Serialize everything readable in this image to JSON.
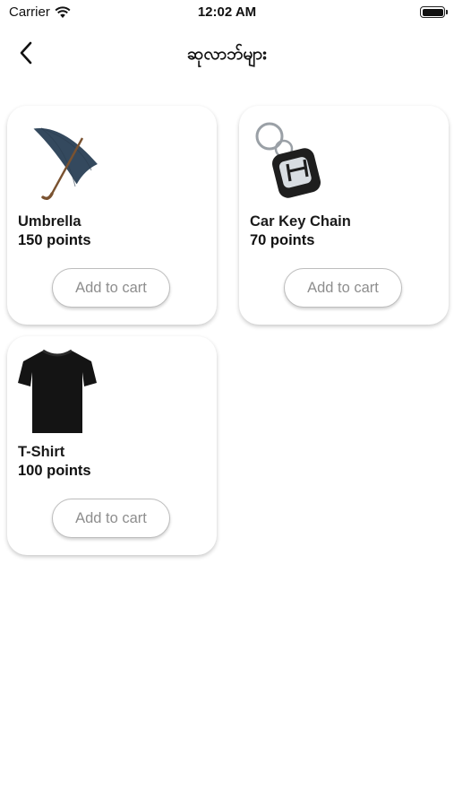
{
  "status_bar": {
    "carrier": "Carrier",
    "time": "12:02 AM"
  },
  "nav": {
    "title": "ဆုလာဘ်များ"
  },
  "products": [
    {
      "name": "Umbrella",
      "points": "150 points",
      "button_label": "Add to cart",
      "icon": "umbrella-image"
    },
    {
      "name": "Car Key Chain",
      "points": "70 points",
      "button_label": "Add to cart",
      "icon": "key-chain-image"
    },
    {
      "name": "T-Shirt",
      "points": "100 points",
      "button_label": "Add to cart",
      "icon": "t-shirt-image"
    }
  ],
  "colors": {
    "button_text": "#8e8e8e",
    "button_border": "#bdbdbd",
    "card_background": "#ffffff"
  }
}
